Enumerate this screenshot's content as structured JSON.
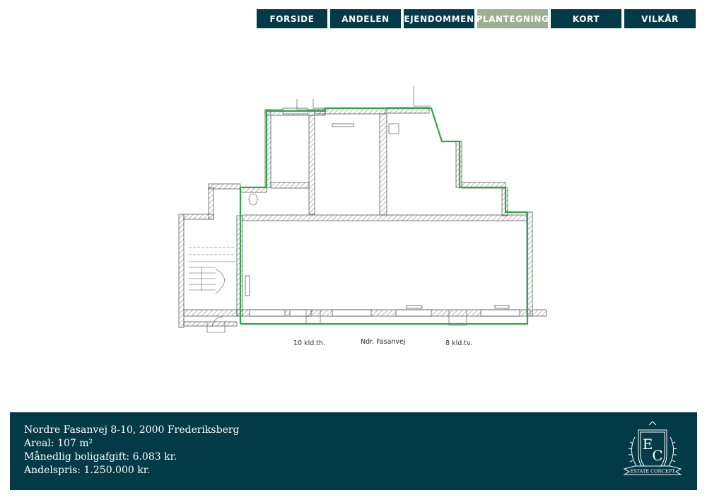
{
  "nav": {
    "tabs": [
      {
        "label": "FORSIDE",
        "active": false
      },
      {
        "label": "ANDELEN",
        "active": false
      },
      {
        "label": "EJENDOMMEN",
        "active": false
      },
      {
        "label": "PLANTEGNING",
        "active": true
      },
      {
        "label": "KORT",
        "active": false
      },
      {
        "label": "VILKÅR",
        "active": false
      }
    ]
  },
  "floorplan": {
    "label_left": "10 kld.th.",
    "label_street": "Ndr. Fasanvej",
    "label_right": "8 kld.tv.",
    "outline_color": "#2aa84a"
  },
  "footer": {
    "address": "Nordre Fasanvej 8-10, 2000 Frederiksberg",
    "area": "Areal: 107 m²",
    "monthly_fee": "Månedlig boligafgift: 6.083 kr.",
    "price": "Andelspris: 1.250.000 kr."
  },
  "logo": {
    "monogram_1": "E",
    "monogram_2": "C",
    "banner": "ESTATE CONCEPT"
  },
  "colors": {
    "primary": "#033a48",
    "active_tab": "#9eb092",
    "outline": "#2aa84a"
  }
}
